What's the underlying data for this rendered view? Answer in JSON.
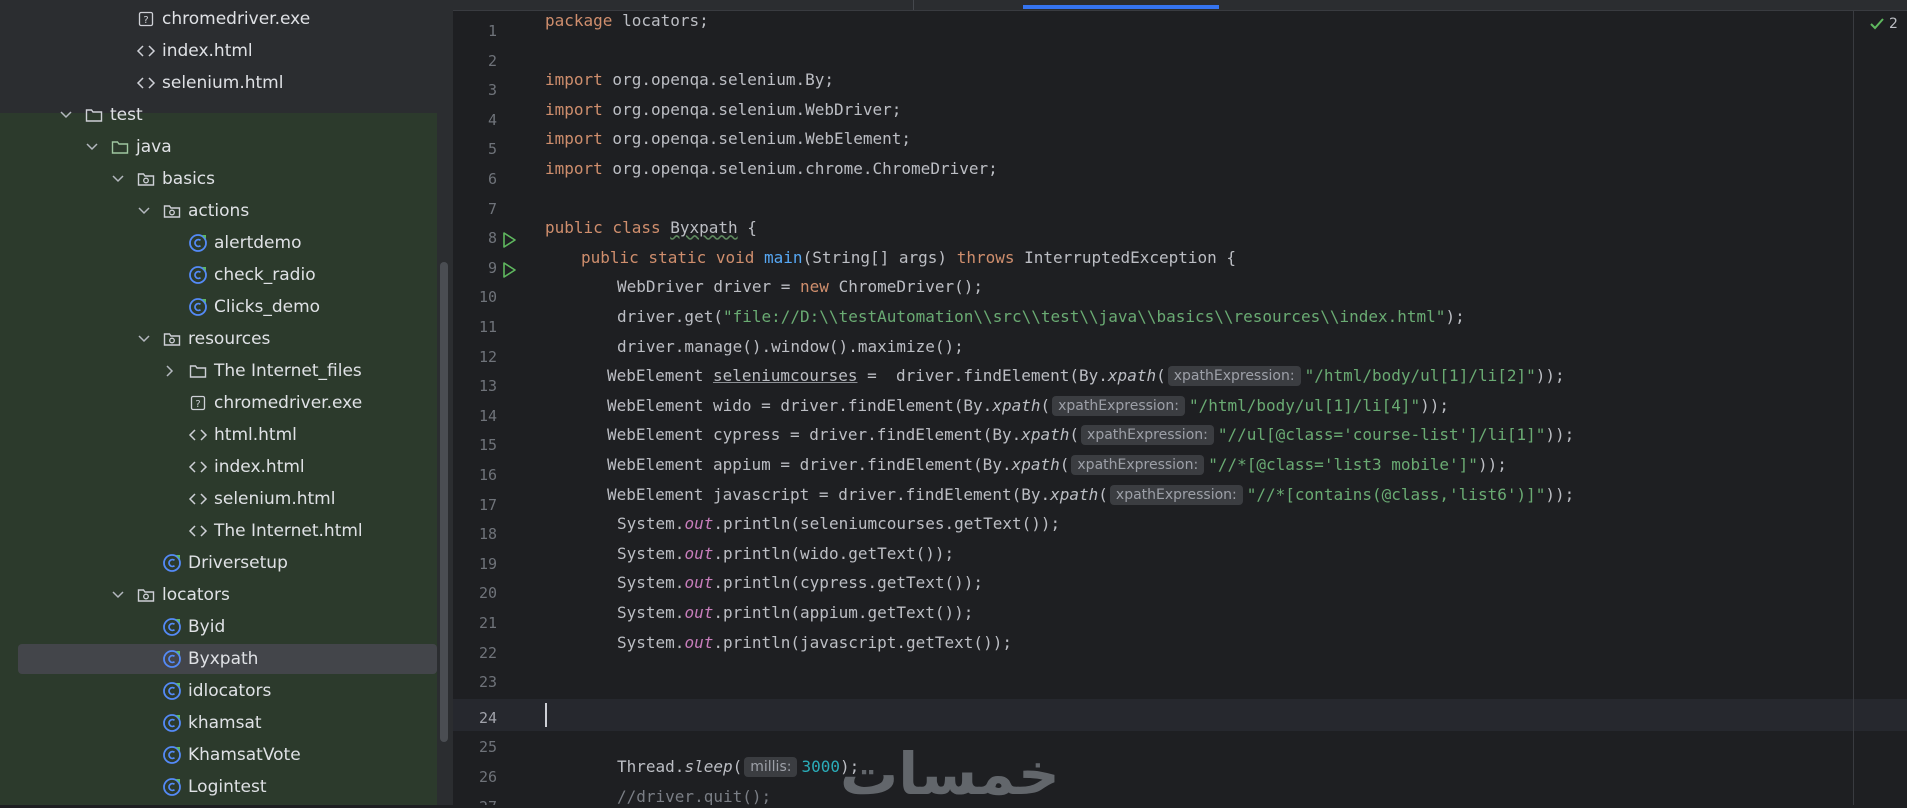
{
  "colors": {
    "accent": "#3574f0",
    "keyword": "#cf8e6d",
    "string": "#6aab73",
    "method": "#56a8f5",
    "number": "#2aacb8",
    "java_class_icon": "#548af7",
    "run_icon": "#5fb85f"
  },
  "project_tree": {
    "rows": [
      {
        "label": "chromedriver.exe",
        "indent": 5,
        "icon": "unknown-file-icon"
      },
      {
        "label": "index.html",
        "indent": 5,
        "icon": "html-file-icon"
      },
      {
        "label": "selenium.html",
        "indent": 5,
        "icon": "html-file-icon"
      },
      {
        "label": "test",
        "indent": 3,
        "icon": "folder-icon",
        "arrow": "expanded"
      },
      {
        "label": "java",
        "indent": 4,
        "icon": "source-folder-icon",
        "arrow": "expanded"
      },
      {
        "label": "basics",
        "indent": 5,
        "icon": "package-icon",
        "arrow": "expanded"
      },
      {
        "label": "actions",
        "indent": 6,
        "icon": "package-icon",
        "arrow": "expanded"
      },
      {
        "label": "alertdemo",
        "indent": 7,
        "icon": "java-class-icon"
      },
      {
        "label": "check_radio",
        "indent": 7,
        "icon": "java-class-icon"
      },
      {
        "label": "Clicks_demo",
        "indent": 7,
        "icon": "java-class-icon"
      },
      {
        "label": "resources",
        "indent": 6,
        "icon": "package-icon",
        "arrow": "expanded"
      },
      {
        "label": "The Internet_files",
        "indent": 7,
        "icon": "folder-icon",
        "arrow": "collapsed"
      },
      {
        "label": "chromedriver.exe",
        "indent": 7,
        "icon": "unknown-file-icon"
      },
      {
        "label": "html.html",
        "indent": 7,
        "icon": "html-file-icon"
      },
      {
        "label": "index.html",
        "indent": 7,
        "icon": "html-file-icon"
      },
      {
        "label": "selenium.html",
        "indent": 7,
        "icon": "html-file-icon"
      },
      {
        "label": "The Internet.html",
        "indent": 7,
        "icon": "html-file-icon"
      },
      {
        "label": "Driversetup",
        "indent": 6,
        "icon": "java-class-icon"
      },
      {
        "label": "locators",
        "indent": 5,
        "icon": "package-icon",
        "arrow": "expanded"
      },
      {
        "label": "Byid",
        "indent": 6,
        "icon": "java-class-icon"
      },
      {
        "label": "Byxpath",
        "indent": 6,
        "icon": "java-class-icon",
        "selected": true
      },
      {
        "label": "idlocators",
        "indent": 6,
        "icon": "java-class-icon"
      },
      {
        "label": "khamsat",
        "indent": 6,
        "icon": "java-class-icon"
      },
      {
        "label": "KhamsatVote",
        "indent": 6,
        "icon": "java-class-icon"
      },
      {
        "label": "Logintest",
        "indent": 6,
        "icon": "java-class-icon"
      }
    ]
  },
  "editor": {
    "current_line": 24,
    "inspection_count": "2",
    "line_numbers": [
      "1",
      "2",
      "3",
      "4",
      "5",
      "6",
      "7",
      "8",
      "9",
      "10",
      "11",
      "12",
      "13",
      "14",
      "15",
      "16",
      "17",
      "18",
      "19",
      "20",
      "21",
      "22",
      "23",
      "24",
      "25",
      "26",
      "27"
    ],
    "run_gutter_lines": [
      8,
      9
    ],
    "code": {
      "l1": {
        "kw": "package",
        "rest": " locators;"
      },
      "l3": {
        "kw": "import",
        "rest": " org.openqa.selenium.By;"
      },
      "l4": {
        "kw": "import",
        "rest": " org.openqa.selenium.WebDriver;"
      },
      "l5": {
        "kw": "import",
        "rest": " org.openqa.selenium.WebElement;"
      },
      "l6": {
        "kw": "import",
        "rest": " org.openqa.selenium.chrome.ChromeDriver;"
      },
      "l8": {
        "kw": "public class",
        "name": "Byxpath",
        "rest": " {"
      },
      "l9": {
        "kw1": "public static void",
        "method": "main",
        "params": "(String[] args) ",
        "kw2": "throws",
        "rest": " InterruptedException {"
      },
      "l10": {
        "pre": "WebDriver driver = ",
        "kw": "new",
        "rest": " ChromeDriver();"
      },
      "l11": {
        "pre": "driver.get(",
        "str": "\"file://D:\\\\testAutomation\\\\src\\\\test\\\\java\\\\basics\\\\resources\\\\index.html\"",
        "rest": ");"
      },
      "l12": {
        "text": "driver.manage().window().maximize();"
      },
      "l13": {
        "type": "WebElement ",
        "var": "seleniumcourses",
        "mid": " =  driver.findElement(By.",
        "call": "xpath",
        "open": "(",
        "hint": "xpathExpression:",
        "str": "\"/html/body/ul[1]/li[2]\"",
        "rest": "));"
      },
      "l14": {
        "pre": "WebElement wido = driver.findElement(By.",
        "call": "xpath",
        "open": "(",
        "hint": "xpathExpression:",
        "str": "\"/html/body/ul[1]/li[4]\"",
        "rest": "));"
      },
      "l15": {
        "pre": "WebElement cypress = driver.findElement(By.",
        "call": "xpath",
        "open": "(",
        "hint": "xpathExpression:",
        "str": "\"//ul[@class='course-list']/li[1]\"",
        "rest": "));"
      },
      "l16": {
        "pre": "WebElement appium = driver.findElement(By.",
        "call": "xpath",
        "open": "(",
        "hint": "xpathExpression:",
        "str": "\"//*[@class='list3 mobile']\"",
        "rest": "));"
      },
      "l17": {
        "pre": "WebElement javascript = driver.findElement(By.",
        "call": "xpath",
        "open": "(",
        "hint": "xpathExpression:",
        "str": "\"//*[contains(@class,'list6')]\"",
        "rest": "));"
      },
      "l18": {
        "pre": "System.",
        "field": "out",
        "rest": ".println(seleniumcourses.getText());"
      },
      "l19": {
        "pre": "System.",
        "field": "out",
        "rest": ".println(wido.getText());"
      },
      "l20": {
        "pre": "System.",
        "field": "out",
        "rest": ".println(cypress.getText());"
      },
      "l21": {
        "pre": "System.",
        "field": "out",
        "rest": ".println(appium.getText());"
      },
      "l22": {
        "pre": "System.",
        "field": "out",
        "rest": ".println(javascript.getText());"
      },
      "l26": {
        "pre": "Thread.",
        "call": "sleep",
        "open": "(",
        "hint": "millis:",
        "num": "3000",
        "rest": ");"
      },
      "l27": {
        "cmt": "//driver.quit();"
      }
    }
  },
  "watermark": "خمسات"
}
